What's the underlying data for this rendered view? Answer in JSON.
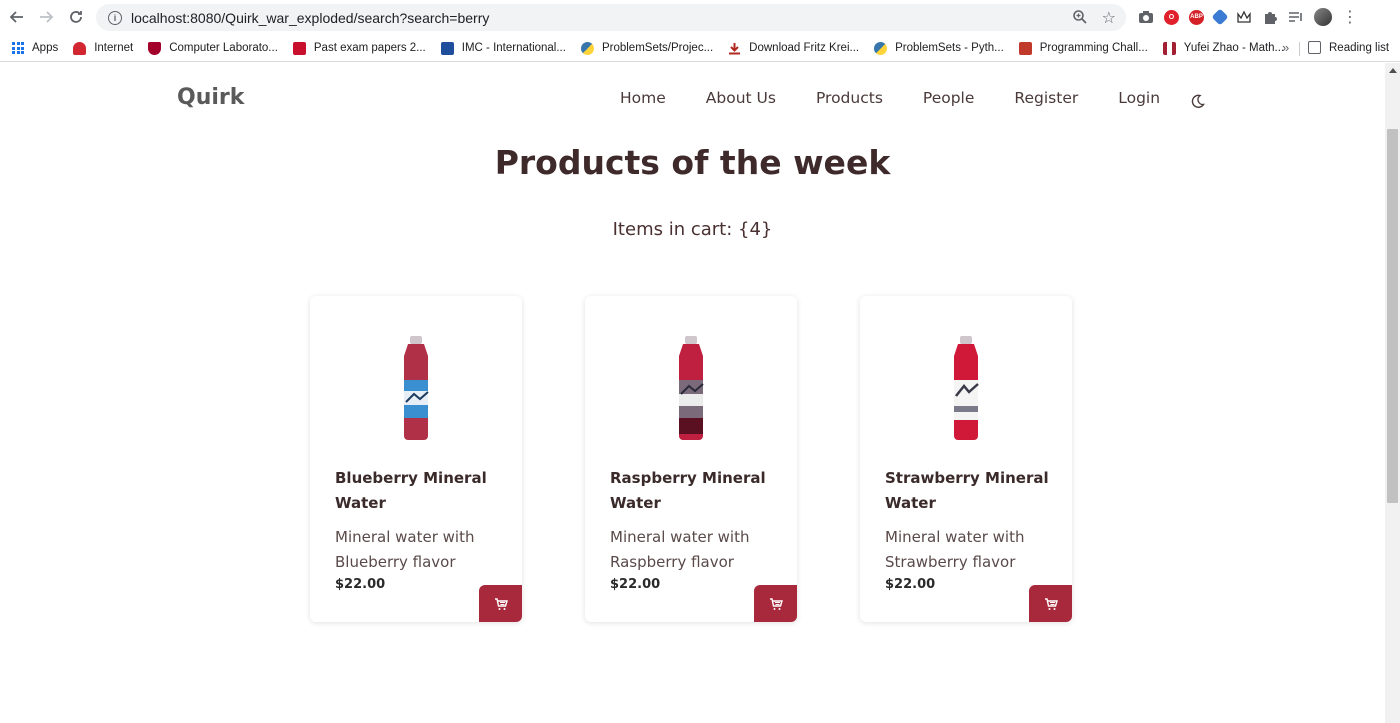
{
  "browser": {
    "url": "localhost:8080/Quirk_war_exploded/search?search=berry",
    "bookmarks": [
      {
        "label": "Apps",
        "icon": "apps-grid-icon"
      },
      {
        "label": "Internet",
        "icon": "huawei-icon",
        "color": "#d22630"
      },
      {
        "label": "Computer Laborato...",
        "icon": "cambridge-shield-icon",
        "color": "#a3002a"
      },
      {
        "label": "Past exam papers 2...",
        "icon": "trinity-icon",
        "color": "#c8102e"
      },
      {
        "label": "IMC - International...",
        "icon": "imc-icon",
        "color": "#1f4e9c"
      },
      {
        "label": "ProblemSets/Projec...",
        "icon": "python-icon",
        "color": "#3776ab"
      },
      {
        "label": "Download Fritz Krei...",
        "icon": "download-icon",
        "color": "#b0281e"
      },
      {
        "label": "ProblemSets - Pyth...",
        "icon": "python-icon",
        "color": "#3776ab"
      },
      {
        "label": "Programming Chall...",
        "icon": "uva-icon",
        "color": "#c0392b"
      },
      {
        "label": "Yufei Zhao - Math...",
        "icon": "mit-icon",
        "color": "#a31f34"
      }
    ],
    "more_label": "»",
    "reading_list": "Reading list"
  },
  "site": {
    "brand": "Quirk",
    "nav": [
      "Home",
      "About Us",
      "Products",
      "People",
      "Register",
      "Login"
    ],
    "headline": "Products of the week",
    "cart_text": "Items in cart: {4}"
  },
  "products": [
    {
      "name": "Blueberry Mineral Water",
      "desc": "Mineral water with Blueberry flavor",
      "price": "$22.00",
      "label_color": "#3a8fd0",
      "cap_color": "#b03048"
    },
    {
      "name": "Raspberry Mineral Water",
      "desc": "Mineral water with Raspberry flavor",
      "price": "$22.00",
      "label_color": "#7a6a7a",
      "cap_color": "#c02040"
    },
    {
      "name": "Strawberry Mineral Water",
      "desc": "Mineral water with Strawberry flavor",
      "price": "$22.00",
      "label_color": "#ffffff",
      "cap_color": "#d01838"
    }
  ],
  "colors": {
    "accent": "#a8283c",
    "heading": "#3e2a2a"
  }
}
